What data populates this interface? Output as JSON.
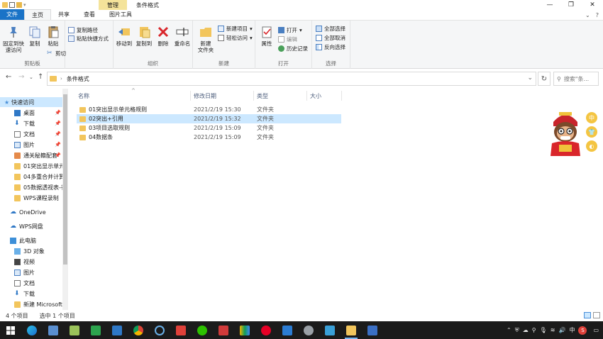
{
  "window": {
    "title": "条件格式",
    "manage_tab": "管理",
    "controls": {
      "minimize": "—",
      "maximize": "❐",
      "close": "✕"
    }
  },
  "ribbon_tabs": {
    "file": "文件",
    "home": "主页",
    "share": "共享",
    "view": "查看",
    "picture_tools": "图片工具"
  },
  "ribbon": {
    "clipboard": {
      "label": "剪贴板",
      "pin_quick_access": "固定到快\n速访问",
      "copy": "复制",
      "paste": "粘贴",
      "copy_path": "复制路径",
      "paste_shortcut": "粘贴快捷方式",
      "cut": "剪切"
    },
    "organize": {
      "label": "组织",
      "move_to": "移动到",
      "copy_to": "复制到",
      "delete": "删除",
      "rename": "重命名"
    },
    "new": {
      "label": "新建",
      "new_folder": "新建\n文件夹",
      "new_item": "新建项目",
      "easy_access": "轻松访问"
    },
    "open": {
      "label": "打开",
      "properties": "属性",
      "open": "打开",
      "edit": "编辑",
      "history": "历史记录"
    },
    "select": {
      "label": "选择",
      "select_all": "全部选择",
      "select_none": "全部取消",
      "invert": "反向选择"
    }
  },
  "address_bar": {
    "path": "条件格式",
    "search_placeholder": "搜索\"条..."
  },
  "nav_pane": {
    "quick_access": "快速访问",
    "items": [
      {
        "label": "桌面",
        "pinned": true
      },
      {
        "label": "下载",
        "pinned": true
      },
      {
        "label": "文档",
        "pinned": true
      },
      {
        "label": "图片",
        "pinned": true
      },
      {
        "label": "通关秘籍配套",
        "pinned": true
      },
      {
        "label": "01突出显示单元",
        "pinned": false
      },
      {
        "label": "04多重合并计算",
        "pinned": false
      },
      {
        "label": "05数据透视表-行",
        "pinned": false
      },
      {
        "label": "WPS课程录制",
        "pinned": false
      }
    ],
    "onedrive": "OneDrive",
    "wps": "WPS网盘",
    "this_pc": "此电脑",
    "pc_items": [
      "3D 对象",
      "视频",
      "图片",
      "文档",
      "下载",
      "新建 Microsoft"
    ]
  },
  "file_list": {
    "columns": {
      "name": "名称",
      "modified": "修改日期",
      "type": "类型",
      "size": "大小"
    },
    "rows": [
      {
        "name": "01突出显示单元格规则",
        "modified": "2021/2/19 15:30",
        "type": "文件夹",
        "selected": false
      },
      {
        "name": "02突出+引用",
        "modified": "2021/2/19 15:32",
        "type": "文件夹",
        "selected": true
      },
      {
        "name": "03项目选取规则",
        "modified": "2021/2/19 15:09",
        "type": "文件夹",
        "selected": false
      },
      {
        "name": "04数据条",
        "modified": "2021/2/19 15:09",
        "type": "文件夹",
        "selected": false
      }
    ]
  },
  "side_tools": {
    "zh": "中"
  },
  "status_bar": {
    "item_count": "4 个项目",
    "selected": "选中 1 个项目"
  },
  "taskbar": {
    "tray_lang": "中",
    "tray_s": "S"
  }
}
